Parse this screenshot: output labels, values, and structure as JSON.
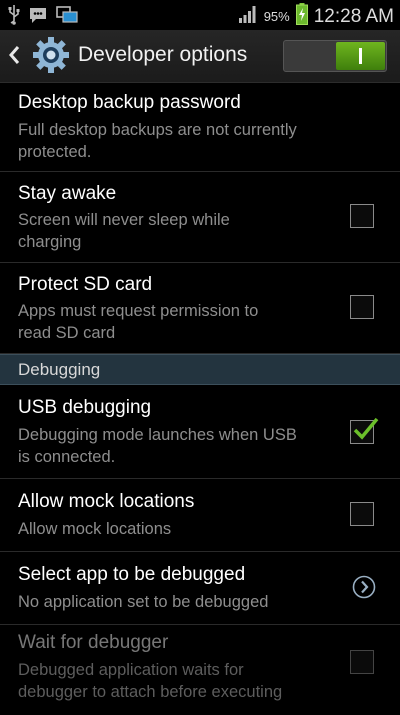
{
  "status_bar": {
    "battery_percent": "95%",
    "time": "12:28 AM",
    "icons": [
      "usb-icon",
      "chat-icon",
      "screen-icon",
      "signal-icon",
      "battery-charging-icon"
    ]
  },
  "action_bar": {
    "title": "Developer options",
    "toggle_on": true
  },
  "rows": [
    {
      "title": "Desktop backup password",
      "subtitle_lines": [
        "Full desktop backups are not currently",
        "protected."
      ],
      "control": "none",
      "enabled": true
    },
    {
      "title": "Stay awake",
      "subtitle_lines": [
        "Screen will never sleep while",
        "charging"
      ],
      "control": "checkbox",
      "checked": false,
      "enabled": true
    },
    {
      "title": "Protect SD card",
      "subtitle_lines": [
        "Apps must request permission to",
        "read SD card"
      ],
      "control": "checkbox",
      "checked": false,
      "enabled": true
    }
  ],
  "section": {
    "label": "Debugging"
  },
  "debug_rows": [
    {
      "title": "USB debugging",
      "subtitle_lines": [
        "Debugging mode launches when USB",
        "is connected."
      ],
      "control": "checkbox",
      "checked": true,
      "enabled": true
    },
    {
      "title": "Allow mock locations",
      "subtitle_lines": [
        "Allow mock locations"
      ],
      "control": "checkbox",
      "checked": false,
      "enabled": true
    },
    {
      "title": "Select app to be debugged",
      "subtitle_lines": [
        "No application set to be debugged"
      ],
      "control": "chevron",
      "enabled": true
    },
    {
      "title": "Wait for debugger",
      "subtitle_lines": [
        "Debugged application waits for",
        "debugger to attach before executing"
      ],
      "control": "checkbox",
      "checked": false,
      "enabled": false
    }
  ],
  "colors": {
    "accent_green": "#6fb51f",
    "section_bg": "#23343f",
    "check_green": "#6bbf2a"
  }
}
